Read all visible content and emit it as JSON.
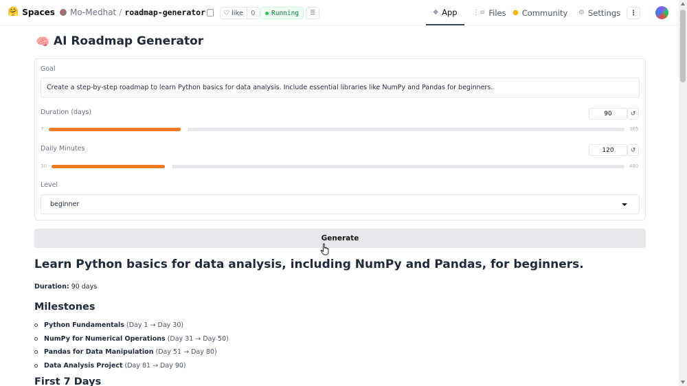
{
  "header": {
    "brand": "Spaces",
    "owner": "Mo-Medhat",
    "separator": "/",
    "repo": "roadmap-generator",
    "like_label": "like",
    "like_count": "0",
    "status": "Running",
    "nav": [
      {
        "label": "App",
        "icon": "cube-icon"
      },
      {
        "label": "Files",
        "icon": "files-icon"
      },
      {
        "label": "Community",
        "icon": "community-icon"
      },
      {
        "label": "Settings",
        "icon": "gear-icon"
      }
    ]
  },
  "app": {
    "title": "AI Roadmap Generator",
    "title_emoji": "🧠",
    "goal": {
      "label": "Goal",
      "value": "Create a step-by-step roadmap to learn Python basics for data analysis. Include essential libraries like NumPy and Pandas for beginners."
    },
    "duration": {
      "label": "Duration (days)",
      "value": "90",
      "min": "7",
      "max": "365",
      "reset": "↺"
    },
    "daily_minutes": {
      "label": "Daily Minutes",
      "value": "120",
      "min": "30",
      "max": "480",
      "reset": "↺"
    },
    "level": {
      "label": "Level",
      "value": "beginner"
    },
    "generate_label": "Generate"
  },
  "output": {
    "heading": "Learn Python basics for data analysis, including NumPy and Pandas, for beginners.",
    "duration_label": "Duration:",
    "duration_value": "90 days",
    "milestones_heading": "Milestones",
    "milestones": [
      {
        "title": "Python Fundamentals",
        "range": "(Day 1 → Day 30)"
      },
      {
        "title": "NumPy for Numerical Operations",
        "range": "(Day 31 → Day 50)"
      },
      {
        "title": "Pandas for Data Manipulation",
        "range": "(Day 51 → Day 80)"
      },
      {
        "title": "Data Analysis Project",
        "range": "(Day 81 → Day 90)"
      }
    ],
    "first7_heading": "First 7 Days"
  },
  "colors": {
    "accent": "#f27a24",
    "running": "#22c55e"
  }
}
